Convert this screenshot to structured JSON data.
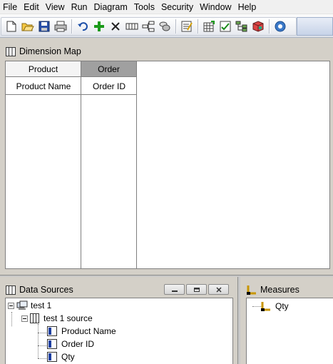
{
  "menu": [
    "File",
    "Edit",
    "View",
    "Run",
    "Diagram",
    "Tools",
    "Security",
    "Window",
    "Help"
  ],
  "toolbar": {
    "icons": [
      "new-file-icon",
      "open-folder-icon",
      "save-icon",
      "print-icon",
      "undo-icon",
      "add-icon",
      "delete-icon",
      "dimension-icon",
      "hierarchy-icon",
      "database-icon",
      "properties-icon",
      "cube-grid-icon",
      "process-icon",
      "tree-icon",
      "cube-icon",
      "help-icon"
    ]
  },
  "dimension_map": {
    "title": "Dimension Map",
    "columns": [
      {
        "header": "Product",
        "selected": false,
        "cell": "Product Name"
      },
      {
        "header": "Order",
        "selected": true,
        "cell": "Order ID"
      }
    ]
  },
  "data_sources": {
    "title": "Data Sources",
    "tree": {
      "root": "test 1",
      "source": "test 1 source",
      "fields": [
        "Product Name",
        "Order ID",
        "Qty"
      ]
    }
  },
  "measures": {
    "title": "Measures",
    "items": [
      "Qty"
    ]
  },
  "colors": {
    "selected_header": "#a0a0a0",
    "menubar": "#f0f0f0",
    "panel_bg": "#d4d0c8"
  }
}
